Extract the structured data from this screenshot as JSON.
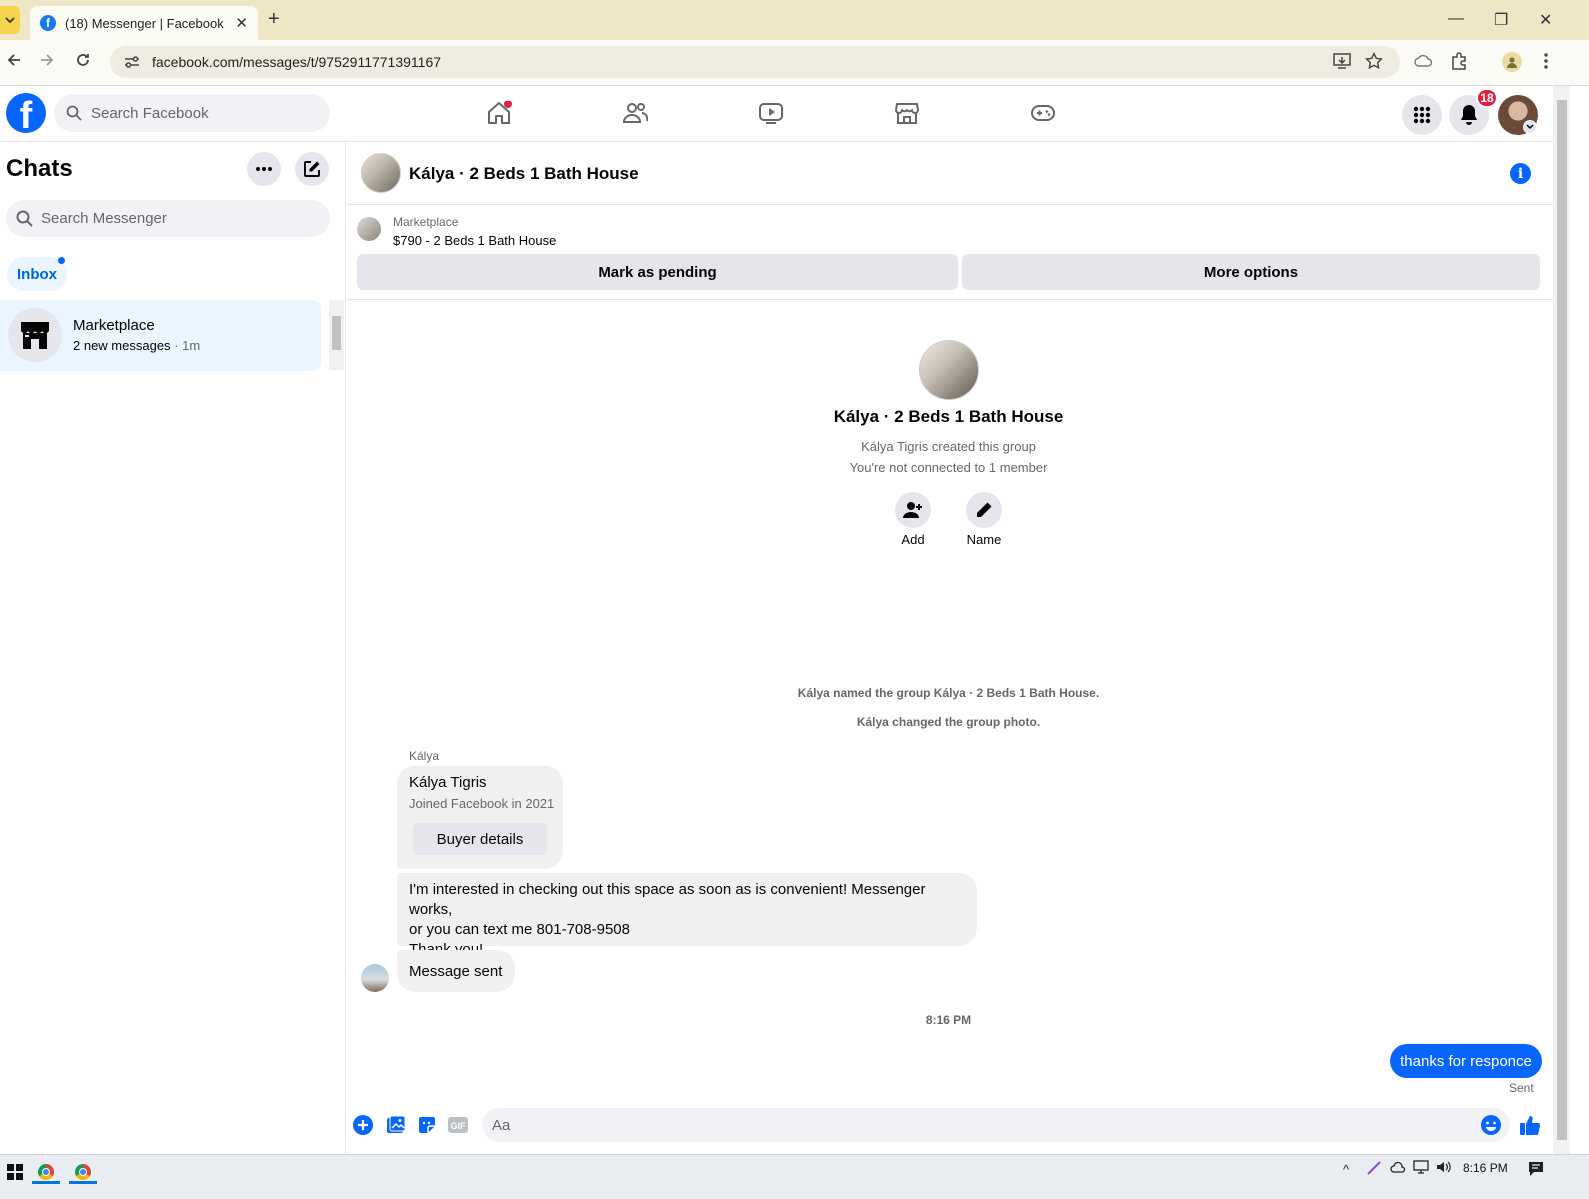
{
  "browser": {
    "tab_title": "(18) Messenger | Facebook",
    "tab_close": "✕",
    "new_tab": "+",
    "url": "facebook.com/messages/t/9752911771391167",
    "window_controls": {
      "minimize": "—",
      "restore": "❐",
      "close": "✕"
    }
  },
  "fb": {
    "logo_letter": "f",
    "search_placeholder": "Search Facebook",
    "notification_count": "18",
    "nav_icons": [
      "home-icon",
      "friends-icon",
      "watch-icon",
      "marketplace-icon",
      "gaming-icon"
    ]
  },
  "chats": {
    "title": "Chats",
    "search_placeholder": "Search Messenger",
    "filter": "Inbox",
    "items": [
      {
        "name": "Marketplace",
        "preview": "2 new messages",
        "time": "· 1m"
      }
    ]
  },
  "conversation": {
    "title": "Kálya · 2 Beds 1 Bath House",
    "listing": {
      "label": "Marketplace",
      "text": "$790 - 2 Beds 1 Bath House",
      "primary_action": "Mark as pending",
      "secondary_action": "More options"
    },
    "intro": {
      "group_name": "Kálya · 2 Beds 1 Bath House",
      "created_by": "Kálya Tigris created this group",
      "connection": "You're not connected to 1 member",
      "actions": [
        {
          "label": "Add",
          "icon": "add-person-icon"
        },
        {
          "label": "Name",
          "icon": "pencil-icon"
        }
      ]
    },
    "system_messages": [
      "Kálya named the group Kálya · 2 Beds 1 Bath House.",
      "Kálya changed the group photo."
    ],
    "sender": "Kálya",
    "buyer_card": {
      "name": "Kálya Tigris",
      "joined": "Joined Facebook in 2021",
      "button": "Buyer details"
    },
    "message": "I'm interested in checking out this space as soon as is convenient! Messenger works,\nor you can text me 801-708-9508\nThank you!",
    "status_bubble": "Message sent",
    "timestamp": "8:16 PM",
    "my_message": "thanks for responce",
    "my_message_status": "Sent",
    "composer_placeholder": "Aa"
  },
  "taskbar": {
    "clock": "8:16 PM",
    "tray_chevron": "^"
  },
  "colors": {
    "accent": "#0866ff",
    "badge": "#e41e3f",
    "bubble_gray": "#f0f0f0",
    "titlebar": "#efe6c6"
  }
}
